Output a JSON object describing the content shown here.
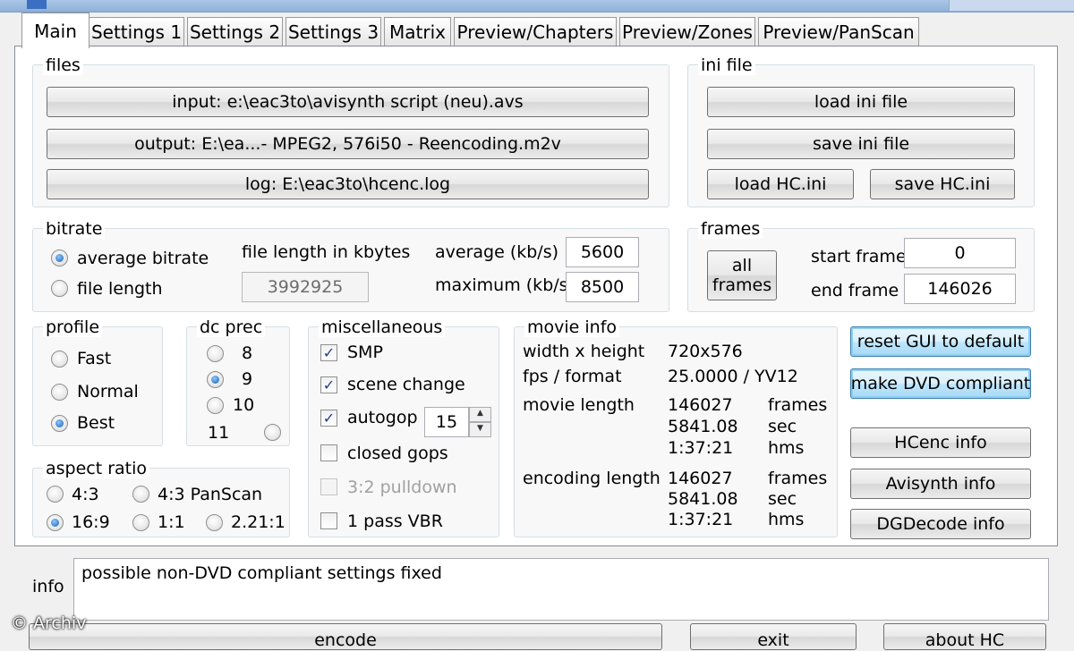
{
  "tabs": [
    "Main",
    "Settings 1",
    "Settings 2",
    "Settings 3",
    "Matrix",
    "Preview/Chapters",
    "Preview/Zones",
    "Preview/PanScan"
  ],
  "files": {
    "legend": "files",
    "input": "input: e:\\eac3to\\avisynth script (neu).avs",
    "output": "output: E:\\ea...- MPEG2, 576i50 - Reencoding.m2v",
    "log": "log: E:\\eac3to\\hcenc.log"
  },
  "ini": {
    "legend": "ini file",
    "load": "load ini file",
    "save": "save ini file",
    "load_hc": "load HC.ini",
    "save_hc": "save HC.ini"
  },
  "bitrate": {
    "legend": "bitrate",
    "avg_label": "average bitrate",
    "filelen_label": "file length",
    "filelen_kbytes_label": "file length in kbytes",
    "filelen_value": "3992925",
    "average_label": "average (kb/s)",
    "average_value": "5600",
    "maximum_label": "maximum (kb/s)",
    "maximum_value": "8500"
  },
  "frames": {
    "legend": "frames",
    "all_line1": "all",
    "all_line2": "frames",
    "start_label": "start frame",
    "start_value": "0",
    "end_label": "end frame",
    "end_value": "146026"
  },
  "profile": {
    "legend": "profile",
    "fast": "Fast",
    "normal": "Normal",
    "best": "Best"
  },
  "dcprec": {
    "legend": "dc prec",
    "v8": "8",
    "v9": "9",
    "v10": "10",
    "v11": "11"
  },
  "misc": {
    "legend": "miscellaneous",
    "smp": "SMP",
    "scene": "scene change",
    "autogop": "autogop",
    "autogop_value": "15",
    "closed": "closed gops",
    "pulldown": "3:2 pulldown",
    "onepass": "1 pass VBR"
  },
  "movie": {
    "legend": "movie info",
    "wh_label": "width x height",
    "wh_value": "720x576",
    "fps_label": "fps / format",
    "fps_value": "25.0000 / YV12",
    "len_label": "movie length",
    "len_frames": "146027",
    "len_sec": "5841.08",
    "len_hms": "1:37:21",
    "enc_label": "encoding length",
    "enc_frames": "146027",
    "enc_sec": "5841.08",
    "enc_hms": "1:37:21",
    "u_frames": "frames",
    "u_sec": "sec",
    "u_hms": "hms"
  },
  "aspect": {
    "legend": "aspect ratio",
    "r43": "4:3",
    "r43ps": "4:3 PanScan",
    "r169": "16:9",
    "r11": "1:1",
    "r221": "2.21:1"
  },
  "actions": {
    "reset": "reset GUI to default",
    "dvd": "make DVD compliant",
    "hcenc": "HCenc info",
    "avisynth": "Avisynth info",
    "dgdecode": "DGDecode info"
  },
  "info": {
    "label": "info",
    "text": "possible non-DVD compliant settings fixed"
  },
  "bottom": {
    "encode": "encode",
    "exit": "exit",
    "about": "about HC"
  },
  "watermark": "© Archiv"
}
